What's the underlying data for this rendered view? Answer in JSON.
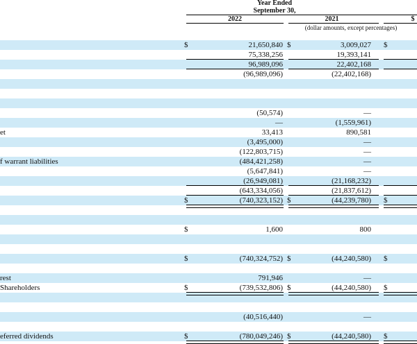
{
  "header": {
    "period_line1": "Year Ended",
    "period_line2": "September 30,",
    "col_2022": "2022",
    "col_2021": "2021",
    "col_third_partial": "$",
    "units_note": "(dollar amounts, except percentages)"
  },
  "rows": [
    {
      "label": "",
      "d1": "",
      "v1": "",
      "d2": "",
      "v2": "",
      "d3": ""
    },
    {
      "label": "",
      "d1": "$",
      "v1": "21,650,840",
      "d2": "$",
      "v2": "3,009,027",
      "d3": "$"
    },
    {
      "label": "",
      "d1": "",
      "v1": "75,338,256",
      "d2": "",
      "v2": "19,393,141",
      "d3": ""
    },
    {
      "label": "",
      "d1": "",
      "v1": "96,989,096",
      "d2": "",
      "v2": "22,402,168",
      "d3": ""
    },
    {
      "label": "",
      "d1": "",
      "v1": "(96,989,096)",
      "d2": "",
      "v2": "(22,402,168)",
      "d3": ""
    },
    {
      "label": "",
      "d1": "",
      "v1": "",
      "d2": "",
      "v2": "",
      "d3": ""
    },
    {
      "label": "",
      "d1": "",
      "v1": "",
      "d2": "",
      "v2": "",
      "d3": ""
    },
    {
      "label": "",
      "d1": "",
      "v1": "",
      "d2": "",
      "v2": "",
      "d3": ""
    },
    {
      "label": "",
      "d1": "",
      "v1": "(50,574)",
      "d2": "",
      "v2": "—",
      "d3": ""
    },
    {
      "label": "",
      "d1": "",
      "v1": "—",
      "d2": "",
      "v2": "(1,559,961)",
      "d3": ""
    },
    {
      "label": "et",
      "d1": "",
      "v1": "33,413",
      "d2": "",
      "v2": "890,581",
      "d3": ""
    },
    {
      "label": "",
      "d1": "",
      "v1": "(3,495,000)",
      "d2": "",
      "v2": "—",
      "d3": ""
    },
    {
      "label": "",
      "d1": "",
      "v1": "(122,803,715)",
      "d2": "",
      "v2": "—",
      "d3": ""
    },
    {
      "label": "f warrant liabilities",
      "d1": "",
      "v1": "(484,421,258)",
      "d2": "",
      "v2": "—",
      "d3": ""
    },
    {
      "label": "",
      "d1": "",
      "v1": "(5,647,841)",
      "d2": "",
      "v2": "—",
      "d3": ""
    },
    {
      "label": "",
      "d1": "",
      "v1": "(26,949,081)",
      "d2": "",
      "v2": "(21,168,232)",
      "d3": ""
    },
    {
      "label": "",
      "d1": "",
      "v1": "(643,334,056)",
      "d2": "",
      "v2": "(21,837,612)",
      "d3": ""
    },
    {
      "label": "",
      "d1": "$",
      "v1": "(740,323,152)",
      "d2": "$",
      "v2": "(44,239,780)",
      "d3": "$"
    },
    {
      "label": "",
      "d1": "",
      "v1": "",
      "d2": "",
      "v2": "",
      "d3": ""
    },
    {
      "label": "",
      "d1": "",
      "v1": "",
      "d2": "",
      "v2": "",
      "d3": ""
    },
    {
      "label": "",
      "d1": "$",
      "v1": "1,600",
      "d2": "",
      "v2": "800",
      "d3": ""
    },
    {
      "label": "",
      "d1": "",
      "v1": "",
      "d2": "",
      "v2": "",
      "d3": ""
    },
    {
      "label": "",
      "d1": "",
      "v1": "",
      "d2": "",
      "v2": "",
      "d3": ""
    },
    {
      "label": "",
      "d1": "$",
      "v1": "(740,324,752)",
      "d2": "$",
      "v2": "(44,240,580)",
      "d3": "$"
    },
    {
      "label": "",
      "d1": "",
      "v1": "",
      "d2": "",
      "v2": "",
      "d3": ""
    },
    {
      "label": "rest",
      "d1": "",
      "v1": "791,946",
      "d2": "",
      "v2": "—",
      "d3": ""
    },
    {
      "label": "Shareholders",
      "d1": "$",
      "v1": "(739,532,806)",
      "d2": "$",
      "v2": "(44,240,580)",
      "d3": "$"
    },
    {
      "label": "",
      "d1": "",
      "v1": "",
      "d2": "",
      "v2": "",
      "d3": ""
    },
    {
      "label": "",
      "d1": "",
      "v1": "",
      "d2": "",
      "v2": "",
      "d3": ""
    },
    {
      "label": "",
      "d1": "",
      "v1": "(40,516,440)",
      "d2": "",
      "v2": "—",
      "d3": ""
    },
    {
      "label": "",
      "d1": "",
      "v1": "",
      "d2": "",
      "v2": "",
      "d3": ""
    },
    {
      "label": "eferred dividends",
      "d1": "$",
      "v1": "(780,049,246)",
      "d2": "$",
      "v2": "(44,240,580)",
      "d3": "$"
    }
  ]
}
